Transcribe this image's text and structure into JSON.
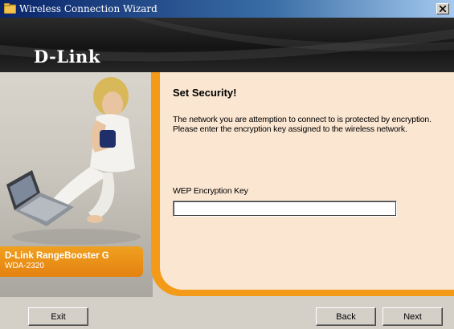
{
  "window": {
    "title": "Wireless Connection Wizard"
  },
  "brand": {
    "logo": "D-Link"
  },
  "product": {
    "name": "D-Link RangeBooster G",
    "model": "WDA-2320"
  },
  "content": {
    "heading": "Set Security!",
    "description": "The network you are attemption to connect to is protected by encryption. Please enter the encryption key assigned to the wireless network.",
    "key_label": "WEP Encryption Key",
    "key_value": ""
  },
  "buttons": {
    "exit": "Exit",
    "back": "Back",
    "next": "Next"
  },
  "colors": {
    "title_bar": "#0a246a",
    "accent_orange": "#f39a18",
    "panel_bg": "#fbe6d2"
  },
  "icons": {
    "window_icon": "wizard-folder-icon",
    "close_icon": "close-icon"
  }
}
